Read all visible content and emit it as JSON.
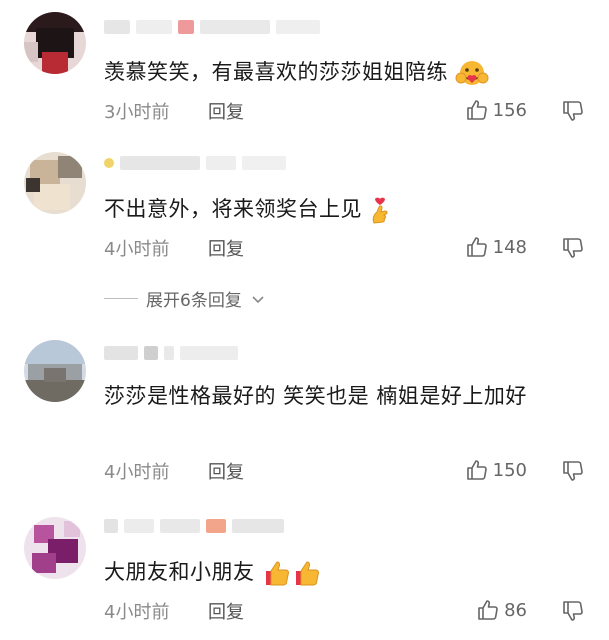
{
  "comments": [
    {
      "text": "羡慕笑笑，有最喜欢的莎莎姐姐陪练",
      "emoji": "hug-emoji",
      "time": "3小时前",
      "reply_label": "回复",
      "likes": "156"
    },
    {
      "text": "不出意外，将来领奖台上见",
      "emoji": "heart-fingers-emoji",
      "time": "4小时前",
      "reply_label": "回复",
      "likes": "148",
      "expand_label": "展开6条回复"
    },
    {
      "text": "莎莎是性格最好的 笑笑也是 楠姐是好上加好",
      "time": "4小时前",
      "reply_label": "回复",
      "likes": "150"
    },
    {
      "text": "大朋友和小朋友",
      "emoji": "thumbs-up-emoji",
      "time": "4小时前",
      "reply_label": "回复",
      "likes": "86"
    }
  ],
  "colors": {
    "text": "#1a1a1a",
    "meta": "#8a8a8a",
    "icon": "#666666",
    "emoji_yellow": "#f7b733",
    "emoji_red": "#e8344a"
  }
}
